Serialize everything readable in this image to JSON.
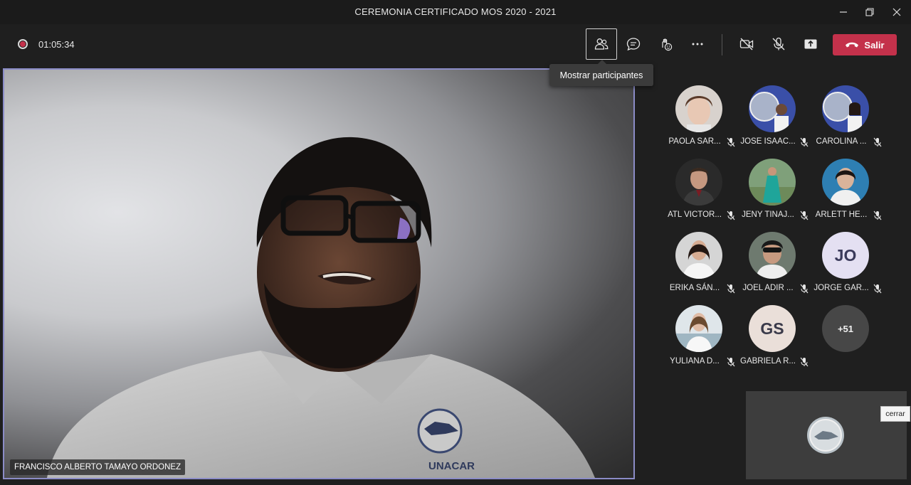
{
  "window": {
    "title": "CEREMONIA CERTIFICADO MOS 2020 - 2021"
  },
  "toolbar": {
    "timer": "01:05:34",
    "tooltip": "Mostrar participantes",
    "leave_label": "Salir",
    "buttons": [
      "participants-icon",
      "chat-icon",
      "reactions-icon",
      "more-icon",
      "camera-off-icon",
      "mic-off-icon",
      "share-icon"
    ]
  },
  "main_video": {
    "speaker_name": "FRANCISCO ALBERTO TAMAYO ORDONEZ",
    "shirt_text": "UNACAR"
  },
  "participants": [
    {
      "name": "PAOLA SAR..."
    },
    {
      "name": "JOSE ISAAC..."
    },
    {
      "name": "CAROLINA ..."
    },
    {
      "name": "ATL VICTOR..."
    },
    {
      "name": "JENY TINAJ..."
    },
    {
      "name": "ARLETT HE..."
    },
    {
      "name": "ERIKA SÁN..."
    },
    {
      "name": "JOEL ADIR ..."
    },
    {
      "name": "JORGE GAR...",
      "initials": "JO"
    },
    {
      "name": "YULIANA D..."
    },
    {
      "name": "GABRIELA R...",
      "initials": "GS"
    },
    {
      "more": "+51"
    }
  ],
  "self_view": {
    "close_label": "cerrar"
  },
  "colors": {
    "accent": "#8b8cc7",
    "leave": "#c4314b",
    "background": "#1f1f1f"
  }
}
